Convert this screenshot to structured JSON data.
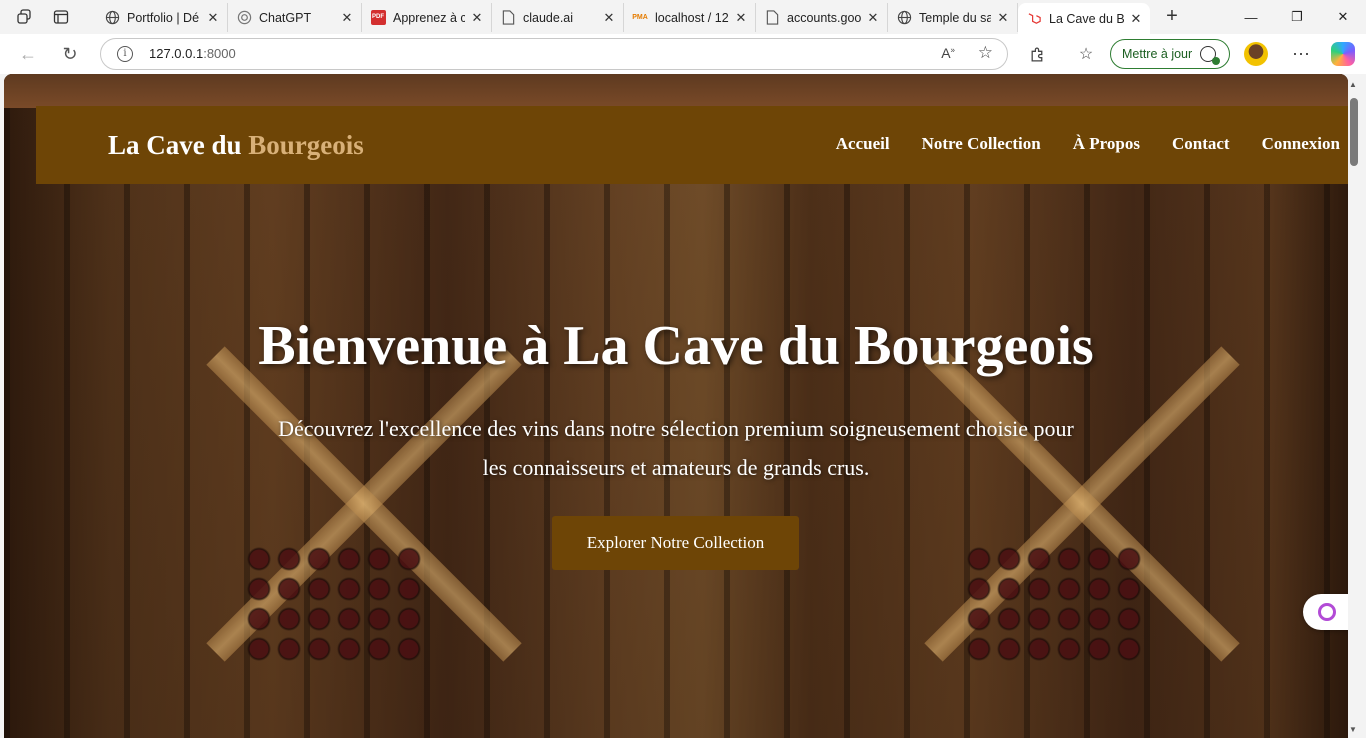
{
  "browser": {
    "tabs": [
      {
        "title": "Portfolio | Dé",
        "icon": "globe-icon"
      },
      {
        "title": "ChatGPT",
        "icon": "chatgpt-icon"
      },
      {
        "title": "Apprenez à c",
        "icon": "pdf-icon"
      },
      {
        "title": "claude.ai",
        "icon": "page-icon"
      },
      {
        "title": "localhost / 12",
        "icon": "phpmyadmin-icon"
      },
      {
        "title": "accounts.goo",
        "icon": "page-icon"
      },
      {
        "title": "Temple du sa",
        "icon": "globe-icon"
      },
      {
        "title": "La Cave du B",
        "icon": "laravel-icon"
      }
    ],
    "active_tab_index": 7,
    "address": {
      "host": "127.0.0.1",
      "port": ":8000"
    },
    "update_button": "Mettre à jour",
    "pdf_glyph": "PDF",
    "pma_glyph": "PMA",
    "icons": {
      "back": "back-arrow-icon",
      "reload": "reload-icon",
      "info": "info-icon",
      "read_aloud": "read-aloud-icon",
      "favorite": "star-icon",
      "extensions": "puzzle-icon",
      "favorites_bar": "favorites-icon",
      "menu": "more-icon",
      "copilot": "copilot-icon"
    }
  },
  "site": {
    "brand_main": "La Cave du",
    "brand_accent": "Bourgeois",
    "nav": [
      "Accueil",
      "Notre Collection",
      "À Propos",
      "Contact",
      "Connexion"
    ],
    "hero_title": "Bienvenue à La Cave du Bourgeois",
    "hero_subtitle": "Découvrez l'excellence des vins dans notre sélection premium soigneusement choisie pour les connaisseurs et amateurs de grands crus.",
    "cta_label": "Explorer Notre Collection"
  },
  "colors": {
    "navbar_bg": "#6e4506",
    "brand_accent": "#d8b078",
    "cta_bg": "#6e4506"
  }
}
